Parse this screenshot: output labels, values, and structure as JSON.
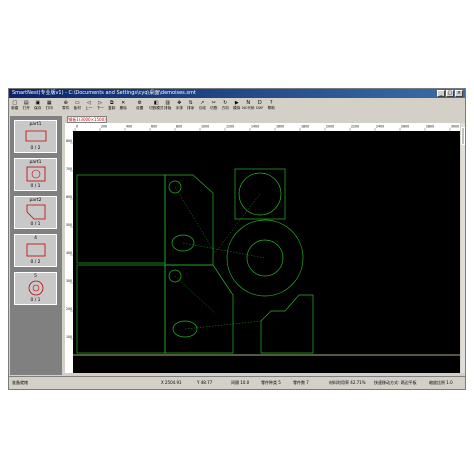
{
  "window": {
    "title": "SmartNest(专业版v1) - C:\\Documents and Settings\\cyq\\桌面\\demoises.smt",
    "min_label": "_",
    "max_label": "□",
    "close_label": "×"
  },
  "toolbar": {
    "items": [
      {
        "name": "new",
        "label": "新建",
        "icon": "□"
      },
      {
        "name": "open",
        "label": "打开",
        "icon": "▤"
      },
      {
        "name": "save",
        "label": "保存",
        "icon": "▣"
      },
      {
        "name": "print",
        "label": "打印",
        "icon": "▦"
      },
      {
        "name": "part",
        "label": "零件",
        "icon": "⊕"
      },
      {
        "name": "material",
        "label": "板材",
        "icon": "▭"
      },
      {
        "name": "undo",
        "label": "上一",
        "icon": "◁"
      },
      {
        "name": "redo",
        "label": "下一",
        "icon": "▷"
      },
      {
        "name": "copy",
        "label": "复制",
        "icon": "⧉"
      },
      {
        "name": "delete",
        "label": "删除",
        "icon": "✕"
      },
      {
        "name": "settings",
        "label": "设置",
        "icon": "⚙"
      },
      {
        "name": "cutmode",
        "label": "切割模式",
        "icon": "◧"
      },
      {
        "name": "nesting",
        "label": "排版",
        "icon": "▥"
      },
      {
        "name": "manual",
        "label": "手排",
        "icon": "✥"
      },
      {
        "name": "sort",
        "label": "排序",
        "icon": "⇅"
      },
      {
        "name": "path",
        "label": "引线",
        "icon": "↗"
      },
      {
        "name": "cut",
        "label": "切割",
        "icon": "✂"
      },
      {
        "name": "direction",
        "label": "方向",
        "icon": "↻"
      },
      {
        "name": "simulate",
        "label": "模拟",
        "icon": "▶"
      },
      {
        "name": "nc",
        "label": "NC代码",
        "icon": "N"
      },
      {
        "name": "dxf",
        "label": "DXF",
        "icon": "D"
      },
      {
        "name": "help",
        "label": "帮助",
        "icon": "?"
      }
    ]
  },
  "tabs": [
    {
      "label": "钢板1(3000×1500)"
    }
  ],
  "parts": [
    {
      "name": "part1",
      "count": "0 / 2"
    },
    {
      "name": "part1",
      "count": "0 / 1"
    },
    {
      "name": "part2",
      "count": "0 / 1"
    },
    {
      "name": "4",
      "count": "0 / 2"
    },
    {
      "name": "5",
      "count": "0 / 1"
    }
  ],
  "ruler": {
    "top": [
      "0",
      "200",
      "400",
      "600",
      "800",
      "1000",
      "1200",
      "1400",
      "1600",
      "1800",
      "2000",
      "2200",
      "2400",
      "2600",
      "2800",
      "3000"
    ],
    "left": [
      "800",
      "700",
      "600",
      "500",
      "400",
      "300",
      "200",
      "100"
    ]
  },
  "status": {
    "ready": "准备就绪",
    "x": "X 2504.91",
    "y": "Y 48.77",
    "gap": "间隔 10.0",
    "parts_count": "零件种类 5",
    "placed": "零件数 7",
    "utilization": "材料利用率 42.71%",
    "move_mode": "快速移动方式: 两边平板",
    "zoom": "缩放比例 1.0"
  },
  "colors": {
    "canvas": "#000000",
    "part_outline": "#28b428",
    "plate_edge": "#e8e8a0",
    "title_bar": "#0a246a"
  }
}
